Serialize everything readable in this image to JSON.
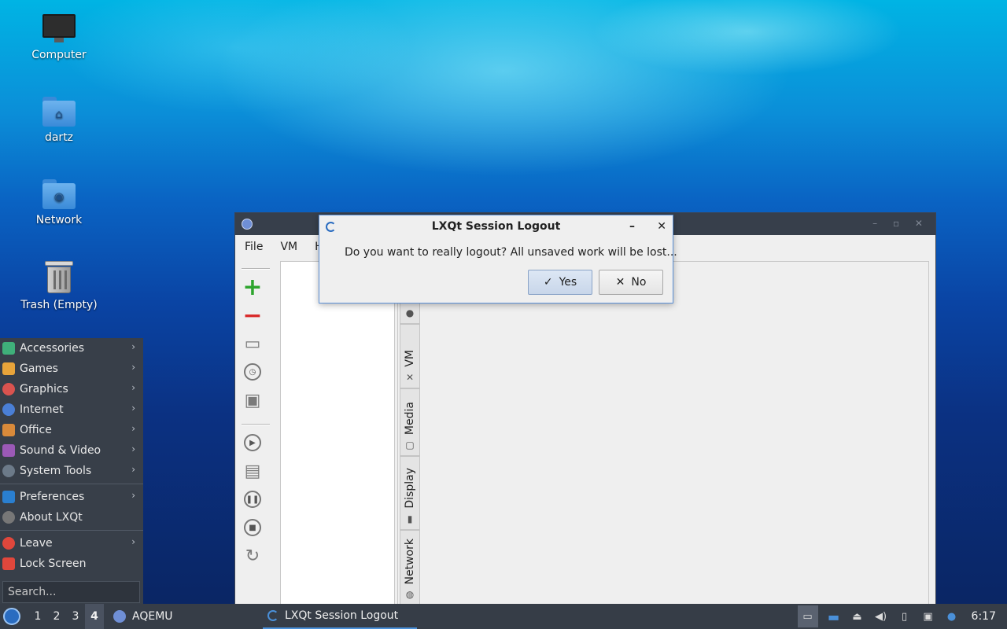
{
  "desktop": {
    "icons": [
      {
        "label": "Computer",
        "icon": "computer-icon"
      },
      {
        "label": "dartz",
        "icon": "home-folder-icon"
      },
      {
        "label": "Network",
        "icon": "network-folder-icon"
      },
      {
        "label": "Trash (Empty)",
        "icon": "trash-icon"
      }
    ]
  },
  "aqemu": {
    "menu": [
      "File",
      "VM",
      "H"
    ],
    "tabs": [
      "VM",
      "Media",
      "Display",
      "Network"
    ]
  },
  "dialog": {
    "title": "LXQt Session Logout",
    "message": "Do you want to really logout? All unsaved work will be lost...",
    "yes_label": "Yes",
    "no_label": "No"
  },
  "start_menu": {
    "categories": [
      {
        "label": "Accessories",
        "color": "#3fb07a"
      },
      {
        "label": "Games",
        "color": "#e8a43a"
      },
      {
        "label": "Graphics",
        "color": "#d9534f"
      },
      {
        "label": "Internet",
        "color": "#4a7fd6"
      },
      {
        "label": "Office",
        "color": "#d98a3a"
      },
      {
        "label": "Sound & Video",
        "color": "#9b59b6"
      },
      {
        "label": "System Tools",
        "color": "#6c7a89"
      }
    ],
    "preferences": "Preferences",
    "about": "About LXQt",
    "leave": "Leave",
    "lock": "Lock Screen",
    "search_placeholder": "Search..."
  },
  "taskbar": {
    "desktops": [
      "1",
      "2",
      "3",
      "4"
    ],
    "active_desktop": "4",
    "tasks": [
      {
        "label": "AQEMU",
        "active": false
      },
      {
        "label": "LXQt Session Logout",
        "active": true
      }
    ],
    "clock": "6:17"
  }
}
